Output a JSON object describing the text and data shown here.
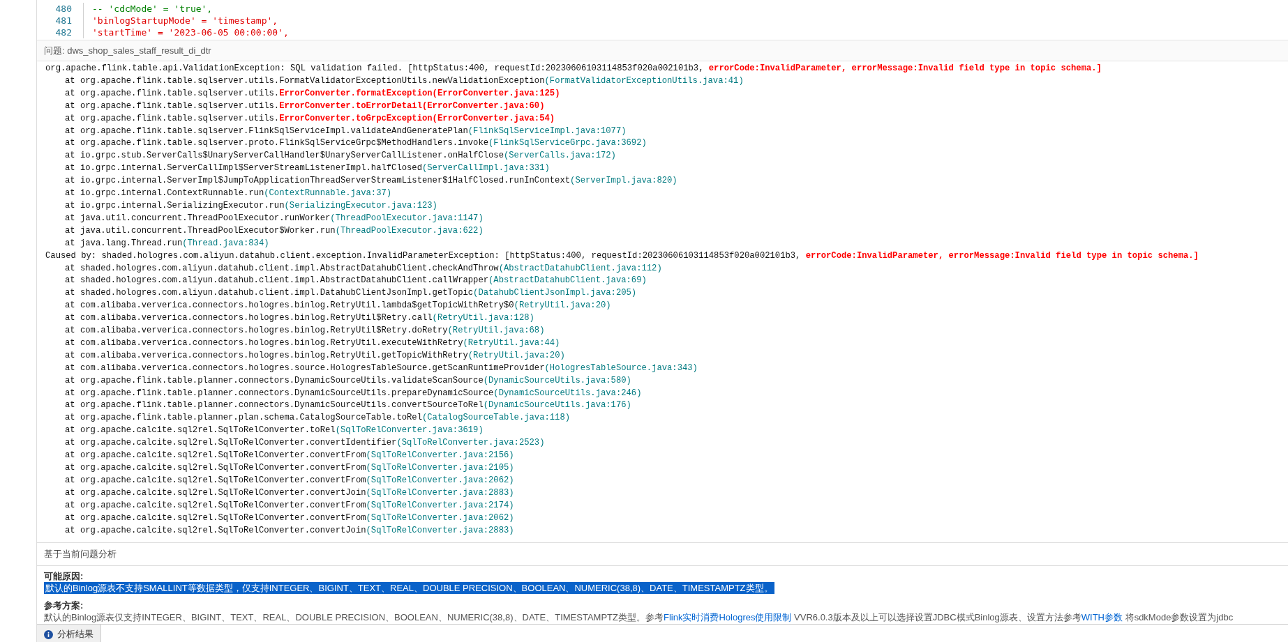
{
  "editor": {
    "lines": [
      {
        "number": "480",
        "tokens": [
          {
            "kind": "comment",
            "text": "-- 'cdcMode' = 'true',"
          }
        ]
      },
      {
        "number": "481",
        "tokens": [
          {
            "kind": "string",
            "text": "'binlogStartupMode' = 'timestamp',"
          }
        ]
      },
      {
        "number": "482",
        "tokens": [
          {
            "kind": "string",
            "text": "'startTime' = '2023-06-05 00:00:00',"
          }
        ]
      }
    ]
  },
  "problem": {
    "label": "问题:",
    "name": "dws_shop_sales_staff_result_di_dtr"
  },
  "trace": [
    {
      "kind": "header",
      "parts": [
        {
          "kind": "plain",
          "text": "org.apache.flink.table.api.ValidationException: SQL validation failed. [httpStatus:400, requestId:20230606103114853f020a002101b3, "
        },
        {
          "kind": "error",
          "text": "errorCode:InvalidParameter, errorMessage:Invalid field type in topic schema.]"
        }
      ]
    },
    {
      "kind": "frame",
      "parts": [
        {
          "kind": "plain",
          "text": "at org.apache.flink.table.sqlserver.utils.FormatValidatorExceptionUtils.newValidationException"
        },
        {
          "kind": "source",
          "text": "(FormatValidatorExceptionUtils.java:41)"
        }
      ]
    },
    {
      "kind": "frame",
      "parts": [
        {
          "kind": "plain",
          "text": "at org.apache.flink.table.sqlserver.utils."
        },
        {
          "kind": "error",
          "text": "ErrorConverter.formatException(ErrorConverter.java:125)"
        }
      ]
    },
    {
      "kind": "frame",
      "parts": [
        {
          "kind": "plain",
          "text": "at org.apache.flink.table.sqlserver.utils."
        },
        {
          "kind": "error",
          "text": "ErrorConverter.toErrorDetail(ErrorConverter.java:60)"
        }
      ]
    },
    {
      "kind": "frame",
      "parts": [
        {
          "kind": "plain",
          "text": "at org.apache.flink.table.sqlserver.utils."
        },
        {
          "kind": "error",
          "text": "ErrorConverter.toGrpcException(ErrorConverter.java:54)"
        }
      ]
    },
    {
      "kind": "frame",
      "parts": [
        {
          "kind": "plain",
          "text": "at org.apache.flink.table.sqlserver.FlinkSqlServiceImpl.validateAndGeneratePlan"
        },
        {
          "kind": "source",
          "text": "(FlinkSqlServiceImpl.java:1077)"
        }
      ]
    },
    {
      "kind": "frame",
      "parts": [
        {
          "kind": "plain",
          "text": "at org.apache.flink.table.sqlserver.proto.FlinkSqlServiceGrpc$MethodHandlers.invoke"
        },
        {
          "kind": "source",
          "text": "(FlinkSqlServiceGrpc.java:3692)"
        }
      ]
    },
    {
      "kind": "frame",
      "parts": [
        {
          "kind": "plain",
          "text": "at io.grpc.stub.ServerCalls$UnaryServerCallHandler$UnaryServerCallListener.onHalfClose"
        },
        {
          "kind": "source",
          "text": "(ServerCalls.java:172)"
        }
      ]
    },
    {
      "kind": "frame",
      "parts": [
        {
          "kind": "plain",
          "text": "at io.grpc.internal.ServerCallImpl$ServerStreamListenerImpl.halfClosed"
        },
        {
          "kind": "source",
          "text": "(ServerCallImpl.java:331)"
        }
      ]
    },
    {
      "kind": "frame",
      "parts": [
        {
          "kind": "plain",
          "text": "at io.grpc.internal.ServerImpl$JumpToApplicationThreadServerStreamListener$1HalfClosed.runInContext"
        },
        {
          "kind": "source",
          "text": "(ServerImpl.java:820)"
        }
      ]
    },
    {
      "kind": "frame",
      "parts": [
        {
          "kind": "plain",
          "text": "at io.grpc.internal.ContextRunnable.run"
        },
        {
          "kind": "source",
          "text": "(ContextRunnable.java:37)"
        }
      ]
    },
    {
      "kind": "frame",
      "parts": [
        {
          "kind": "plain",
          "text": "at io.grpc.internal.SerializingExecutor.run"
        },
        {
          "kind": "source",
          "text": "(SerializingExecutor.java:123)"
        }
      ]
    },
    {
      "kind": "frame",
      "parts": [
        {
          "kind": "plain",
          "text": "at java.util.concurrent.ThreadPoolExecutor.runWorker"
        },
        {
          "kind": "source",
          "text": "(ThreadPoolExecutor.java:1147)"
        }
      ]
    },
    {
      "kind": "frame",
      "parts": [
        {
          "kind": "plain",
          "text": "at java.util.concurrent.ThreadPoolExecutor$Worker.run"
        },
        {
          "kind": "source",
          "text": "(ThreadPoolExecutor.java:622)"
        }
      ]
    },
    {
      "kind": "frame",
      "parts": [
        {
          "kind": "plain",
          "text": "at java.lang.Thread.run"
        },
        {
          "kind": "source",
          "text": "(Thread.java:834)"
        }
      ]
    },
    {
      "kind": "header",
      "parts": [
        {
          "kind": "plain",
          "text": "Caused by: shaded.hologres.com.aliyun.datahub.client.exception.InvalidParameterException: [httpStatus:400, requestId:20230606103114853f020a002101b3, "
        },
        {
          "kind": "error",
          "text": "errorCode:InvalidParameter, errorMessage:Invalid field type in topic schema.]"
        }
      ]
    },
    {
      "kind": "frame",
      "parts": [
        {
          "kind": "plain",
          "text": "at shaded.hologres.com.aliyun.datahub.client.impl.AbstractDatahubClient.checkAndThrow"
        },
        {
          "kind": "source",
          "text": "(AbstractDatahubClient.java:112)"
        }
      ]
    },
    {
      "kind": "frame",
      "parts": [
        {
          "kind": "plain",
          "text": "at shaded.hologres.com.aliyun.datahub.client.impl.AbstractDatahubClient.callWrapper"
        },
        {
          "kind": "source",
          "text": "(AbstractDatahubClient.java:69)"
        }
      ]
    },
    {
      "kind": "frame",
      "parts": [
        {
          "kind": "plain",
          "text": "at shaded.hologres.com.aliyun.datahub.client.impl.DatahubClientJsonImpl.getTopic"
        },
        {
          "kind": "source",
          "text": "(DatahubClientJsonImpl.java:205)"
        }
      ]
    },
    {
      "kind": "frame",
      "parts": [
        {
          "kind": "plain",
          "text": "at com.alibaba.ververica.connectors.hologres.binlog.RetryUtil.lambda$getTopicWithRetry$0"
        },
        {
          "kind": "source",
          "text": "(RetryUtil.java:20)"
        }
      ]
    },
    {
      "kind": "frame",
      "parts": [
        {
          "kind": "plain",
          "text": "at com.alibaba.ververica.connectors.hologres.binlog.RetryUtil$Retry.call"
        },
        {
          "kind": "source",
          "text": "(RetryUtil.java:128)"
        }
      ]
    },
    {
      "kind": "frame",
      "parts": [
        {
          "kind": "plain",
          "text": "at com.alibaba.ververica.connectors.hologres.binlog.RetryUtil$Retry.doRetry"
        },
        {
          "kind": "source",
          "text": "(RetryUtil.java:68)"
        }
      ]
    },
    {
      "kind": "frame",
      "parts": [
        {
          "kind": "plain",
          "text": "at com.alibaba.ververica.connectors.hologres.binlog.RetryUtil.executeWithRetry"
        },
        {
          "kind": "source",
          "text": "(RetryUtil.java:44)"
        }
      ]
    },
    {
      "kind": "frame",
      "parts": [
        {
          "kind": "plain",
          "text": "at com.alibaba.ververica.connectors.hologres.binlog.RetryUtil.getTopicWithRetry"
        },
        {
          "kind": "source",
          "text": "(RetryUtil.java:20)"
        }
      ]
    },
    {
      "kind": "frame",
      "parts": [
        {
          "kind": "plain",
          "text": "at com.alibaba.ververica.connectors.hologres.source.HologresTableSource.getScanRuntimeProvider"
        },
        {
          "kind": "source",
          "text": "(HologresTableSource.java:343)"
        }
      ]
    },
    {
      "kind": "frame",
      "parts": [
        {
          "kind": "plain",
          "text": "at org.apache.flink.table.planner.connectors.DynamicSourceUtils.validateScanSource"
        },
        {
          "kind": "source",
          "text": "(DynamicSourceUtils.java:580)"
        }
      ]
    },
    {
      "kind": "frame",
      "parts": [
        {
          "kind": "plain",
          "text": "at org.apache.flink.table.planner.connectors.DynamicSourceUtils.prepareDynamicSource"
        },
        {
          "kind": "source",
          "text": "(DynamicSourceUtils.java:246)"
        }
      ]
    },
    {
      "kind": "frame",
      "parts": [
        {
          "kind": "plain",
          "text": "at org.apache.flink.table.planner.connectors.DynamicSourceUtils.convertSourceToRel"
        },
        {
          "kind": "source",
          "text": "(DynamicSourceUtils.java:176)"
        }
      ]
    },
    {
      "kind": "frame",
      "parts": [
        {
          "kind": "plain",
          "text": "at org.apache.flink.table.planner.plan.schema.CatalogSourceTable.toRel"
        },
        {
          "kind": "source",
          "text": "(CatalogSourceTable.java:118)"
        }
      ]
    },
    {
      "kind": "frame",
      "parts": [
        {
          "kind": "plain",
          "text": "at org.apache.calcite.sql2rel.SqlToRelConverter.toRel"
        },
        {
          "kind": "source",
          "text": "(SqlToRelConverter.java:3619)"
        }
      ]
    },
    {
      "kind": "frame",
      "parts": [
        {
          "kind": "plain",
          "text": "at org.apache.calcite.sql2rel.SqlToRelConverter.convertIdentifier"
        },
        {
          "kind": "source",
          "text": "(SqlToRelConverter.java:2523)"
        }
      ]
    },
    {
      "kind": "frame",
      "parts": [
        {
          "kind": "plain",
          "text": "at org.apache.calcite.sql2rel.SqlToRelConverter.convertFrom"
        },
        {
          "kind": "source",
          "text": "(SqlToRelConverter.java:2156)"
        }
      ]
    },
    {
      "kind": "frame",
      "parts": [
        {
          "kind": "plain",
          "text": "at org.apache.calcite.sql2rel.SqlToRelConverter.convertFrom"
        },
        {
          "kind": "source",
          "text": "(SqlToRelConverter.java:2105)"
        }
      ]
    },
    {
      "kind": "frame",
      "parts": [
        {
          "kind": "plain",
          "text": "at org.apache.calcite.sql2rel.SqlToRelConverter.convertFrom"
        },
        {
          "kind": "source",
          "text": "(SqlToRelConverter.java:2062)"
        }
      ]
    },
    {
      "kind": "frame",
      "parts": [
        {
          "kind": "plain",
          "text": "at org.apache.calcite.sql2rel.SqlToRelConverter.convertJoin"
        },
        {
          "kind": "source",
          "text": "(SqlToRelConverter.java:2883)"
        }
      ]
    },
    {
      "kind": "frame",
      "parts": [
        {
          "kind": "plain",
          "text": "at org.apache.calcite.sql2rel.SqlToRelConverter.convertFrom"
        },
        {
          "kind": "source",
          "text": "(SqlToRelConverter.java:2174)"
        }
      ]
    },
    {
      "kind": "frame",
      "parts": [
        {
          "kind": "plain",
          "text": "at org.apache.calcite.sql2rel.SqlToRelConverter.convertFrom"
        },
        {
          "kind": "source",
          "text": "(SqlToRelConverter.java:2062)"
        }
      ]
    },
    {
      "kind": "frame",
      "parts": [
        {
          "kind": "plain",
          "text": "at org.apache.calcite.sql2rel.SqlToRelConverter.convertJoin"
        },
        {
          "kind": "source",
          "text": "(SqlToRelConverter.java:2883)"
        }
      ]
    }
  ],
  "analysis": {
    "title": "基于当前问题分析",
    "sections": [
      {
        "heading": "可能原因:",
        "highlighted": true,
        "parts": [
          {
            "kind": "text",
            "text": "默认的Binlog源表不支持SMALLINT等数据类型，仅支持INTEGER、BIGINT、TEXT、REAL、DOUBLE PRECISION、BOOLEAN、NUMERIC(38,8)、DATE、TIMESTAMPTZ类型。"
          }
        ]
      },
      {
        "heading": "参考方案:",
        "highlighted": false,
        "parts": [
          {
            "kind": "text",
            "text": "默认的Binlog源表仅支持INTEGER、BIGINT、TEXT、REAL、DOUBLE PRECISION、BOOLEAN、NUMERIC(38,8)、DATE、TIMESTAMPTZ类型。参考"
          },
          {
            "kind": "link",
            "text": "Flink实时消费Hologres使用限制"
          },
          {
            "kind": "text",
            "text": " VVR6.0.3版本及以上可以选择设置JDBC模式Binlog源表、设置方法参考"
          },
          {
            "kind": "link",
            "text": "WITH参数"
          },
          {
            "kind": "text",
            "text": " 将sdkMode参数设置为jdbc"
          }
        ]
      }
    ]
  },
  "bottom_tabs": [
    {
      "label": "分析结果",
      "selected": true
    }
  ]
}
